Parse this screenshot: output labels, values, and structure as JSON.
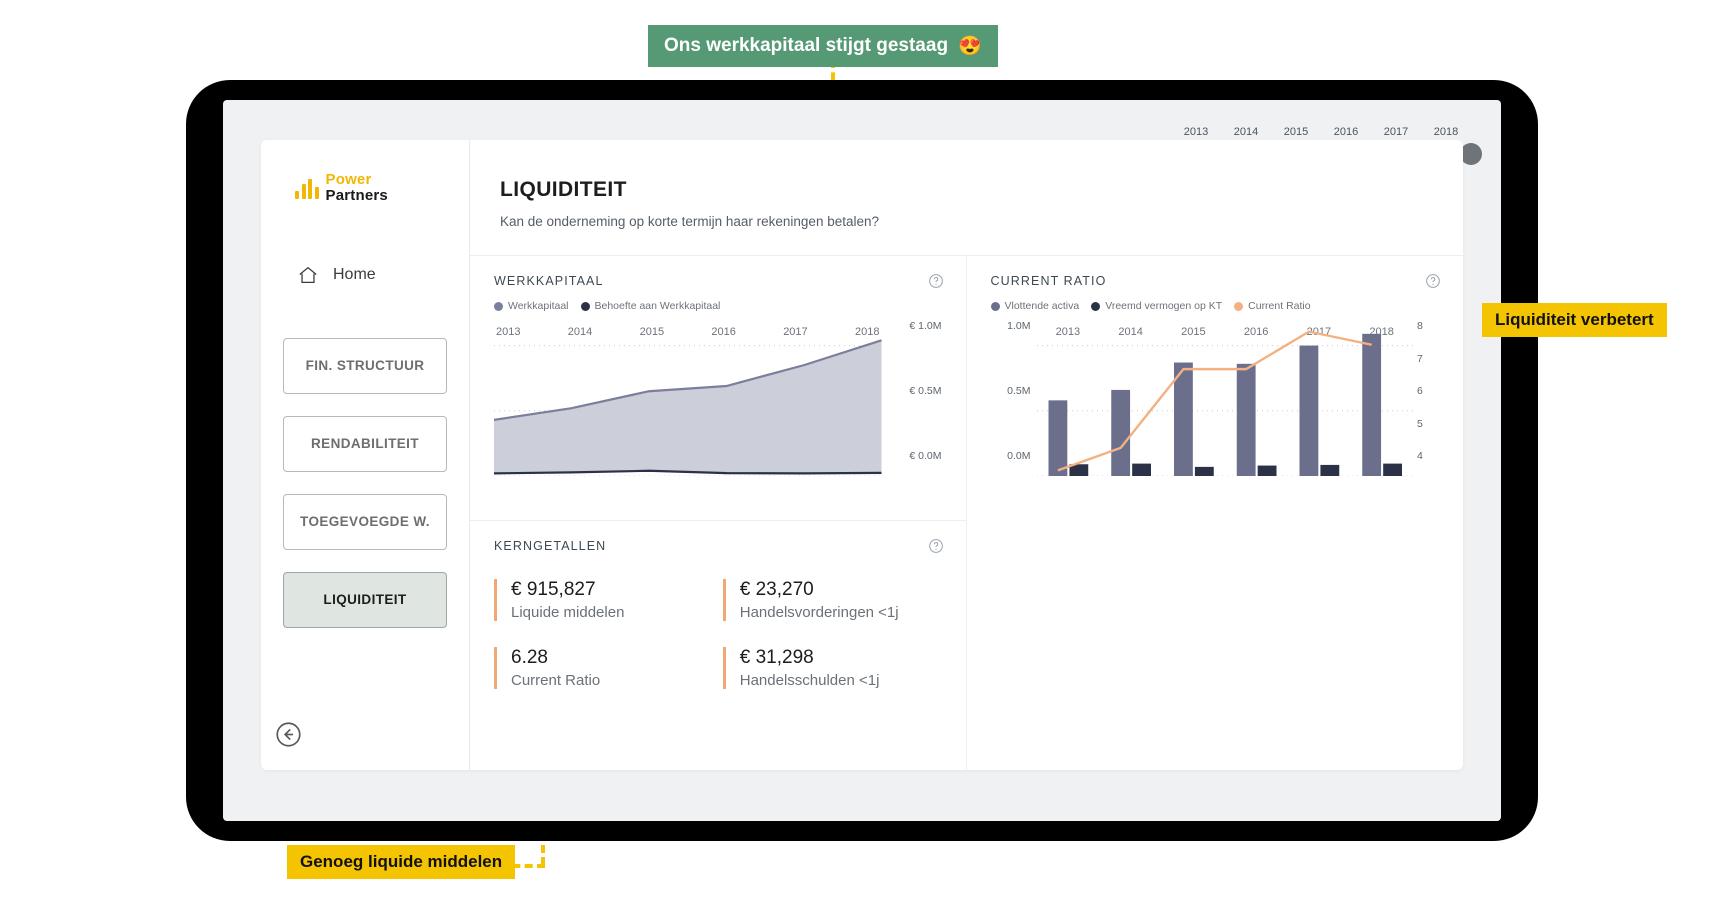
{
  "annotations": {
    "top": {
      "text": "Ons werkkapitaal stijgt gestaag",
      "emoji": "😍",
      "color": "#569975",
      "text_color": "#ffffff"
    },
    "right": {
      "text": "Liquiditeit verbetert",
      "color": "#f5c400"
    },
    "bottom": {
      "text": "Genoeg liquide middelen",
      "color": "#f5c400"
    }
  },
  "sidebar": {
    "logo": {
      "line1": "Power",
      "line2": "Partners",
      "accent": "#f2b705"
    },
    "home": {
      "label": "Home",
      "icon": "home-icon"
    },
    "nav_items": [
      {
        "label": "FIN. STRUCTUUR",
        "active": false
      },
      {
        "label": "RENDABILITEIT",
        "active": false
      },
      {
        "label": "TOEGEVOEGDE W.",
        "active": false
      },
      {
        "label": "LIQUIDITEIT",
        "active": true
      }
    ],
    "back": {
      "icon": "back-arrow-circle-icon"
    }
  },
  "header": {
    "title": "LIQUIDITEIT",
    "subtitle": "Kan de onderneming op korte termijn haar rekeningen betalen?"
  },
  "year_slider": {
    "years": [
      "2013",
      "2014",
      "2015",
      "2016",
      "2017",
      "2018"
    ],
    "selected_start": "2013",
    "selected_end": "2018"
  },
  "cards": {
    "werkkapitaal": {
      "title": "WERKKAPITAAL",
      "help": "?",
      "legend": [
        {
          "label": "Werkkapitaal",
          "color": "#7c7f9c"
        },
        {
          "label": "Behoefte aan Werkkapitaal",
          "color": "#2b3147"
        }
      ]
    },
    "current_ratio": {
      "title": "CURRENT RATIO",
      "help": "?",
      "legend": [
        {
          "label": "Vlottende activa",
          "color": "#6b6f8c"
        },
        {
          "label": "Vreemd vermogen op KT",
          "color": "#2b3147"
        },
        {
          "label": "Current Ratio",
          "color": "#f3b183"
        }
      ]
    },
    "kerngetallen": {
      "title": "KERNGETALLEN",
      "help": "?",
      "items": [
        {
          "value": "€ 915,827",
          "label": "Liquide middelen"
        },
        {
          "value": "€ 23,270",
          "label": "Handelsvorderingen <1j"
        },
        {
          "value": "6.28",
          "label": "Current Ratio"
        },
        {
          "value": "€ 31,298",
          "label": "Handelsschulden <1j"
        }
      ]
    }
  },
  "chart_data": [
    {
      "id": "werkkapitaal",
      "type": "area",
      "title": "WERKKAPITAAL",
      "xlabel": "",
      "ylabel": "",
      "categories": [
        "2013",
        "2014",
        "2015",
        "2016",
        "2017",
        "2018"
      ],
      "ytick_labels": [
        "€ 1.0M",
        "€ 0.5M",
        "€ 0.0M"
      ],
      "ytick_values": [
        1000000,
        500000,
        0
      ],
      "ylim": [
        0,
        1150000
      ],
      "grid": true,
      "legend_position": "top-left",
      "series": [
        {
          "name": "Werkkapitaal",
          "color": "#7c7f9c",
          "values": [
            430000,
            520000,
            650000,
            690000,
            850000,
            1040000
          ]
        },
        {
          "name": "Behoefte aan Werkkapitaal",
          "color": "#2b3147",
          "values": [
            20000,
            28000,
            40000,
            22000,
            20000,
            24000
          ]
        }
      ]
    },
    {
      "id": "current_ratio",
      "type": "bar",
      "title": "CURRENT RATIO",
      "categories": [
        "2013",
        "2014",
        "2015",
        "2016",
        "2017",
        "2018"
      ],
      "ytick_labels_left": [
        "1.0M",
        "0.5M",
        "0.0M"
      ],
      "ylim_left": [
        0,
        1150000
      ],
      "ytick_labels_right": [
        "8",
        "7",
        "6",
        "5",
        "4"
      ],
      "ylim_right": [
        4,
        8
      ],
      "grid": true,
      "legend_position": "top-left",
      "series": [
        {
          "name": "Vlottende activa",
          "type": "bar",
          "color": "#6b6f8c",
          "values": [
            580000,
            660000,
            870000,
            860000,
            1000000,
            1090000
          ]
        },
        {
          "name": "Vreemd vermogen op KT",
          "type": "bar",
          "color": "#2b3147",
          "values": [
            90000,
            95000,
            70000,
            80000,
            85000,
            95000
          ]
        },
        {
          "name": "Current Ratio",
          "type": "line",
          "color": "#f3b183",
          "values": [
            4.15,
            4.75,
            6.85,
            6.85,
            7.85,
            7.5
          ]
        }
      ]
    }
  ]
}
